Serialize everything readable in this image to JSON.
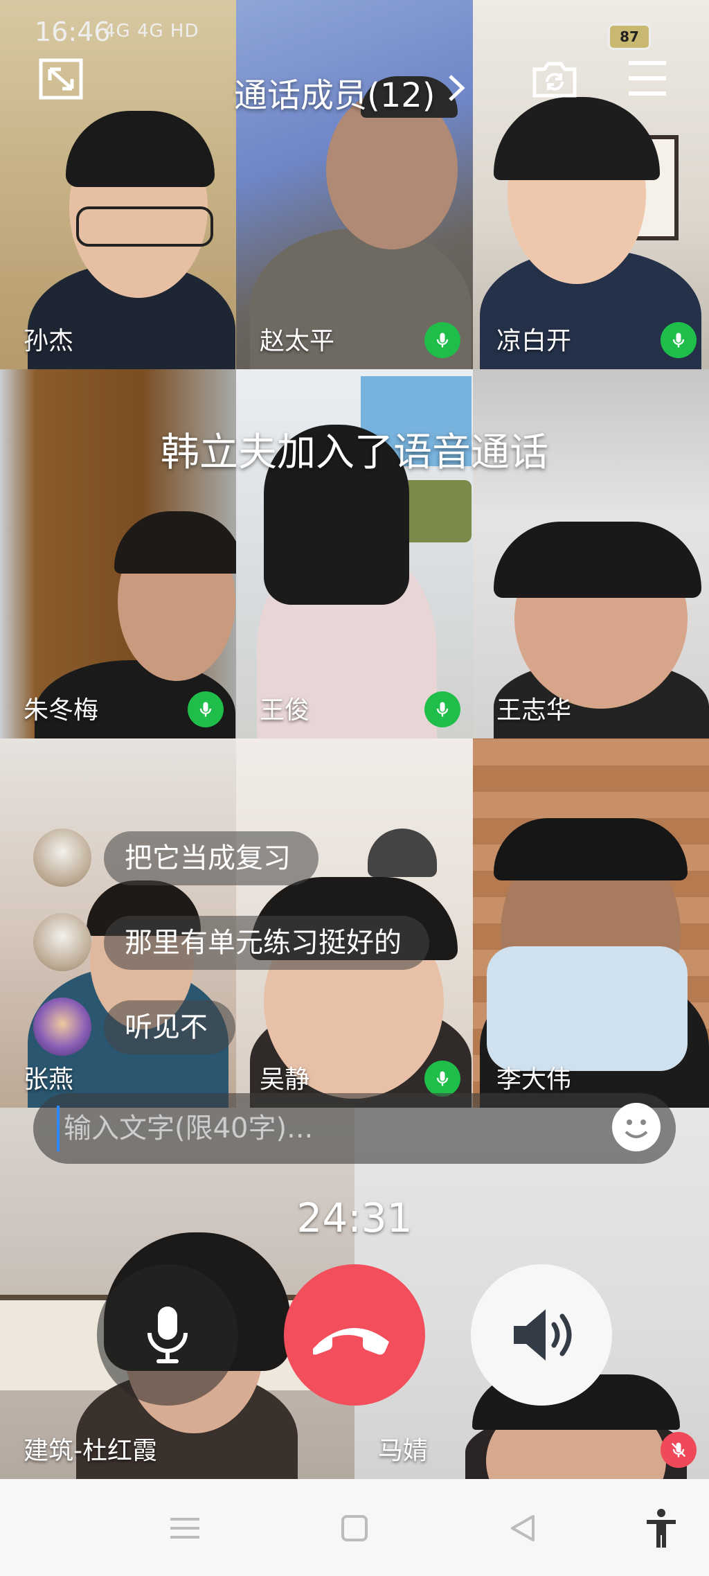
{
  "status_bar": {
    "time": "16:46",
    "signal_text": "4G  4G  HD",
    "battery": "87"
  },
  "header": {
    "members_title": "通话成员(12)"
  },
  "participants": [
    {
      "name": "孙杰"
    },
    {
      "name": "赵太平"
    },
    {
      "name": "凉白开"
    },
    {
      "name": "朱冬梅"
    },
    {
      "name": "王俊"
    },
    {
      "name": "王志华"
    },
    {
      "name": "张燕"
    },
    {
      "name": "吴静"
    },
    {
      "name": "李大伟"
    },
    {
      "name": "建筑-杜红霞"
    },
    {
      "name": "马婧"
    }
  ],
  "notice": "韩立夫加入了语音通话",
  "chat_messages": [
    {
      "text": "把它当成复习"
    },
    {
      "text": "那里有单元练习挺好的"
    },
    {
      "text": "听见不"
    }
  ],
  "input": {
    "placeholder": "输入文字(限40字)..."
  },
  "timer": "24:31",
  "colors": {
    "hangup": "#f34e5c",
    "mic_active": "#1fbd4a",
    "mic_muted": "#f04a5a"
  }
}
